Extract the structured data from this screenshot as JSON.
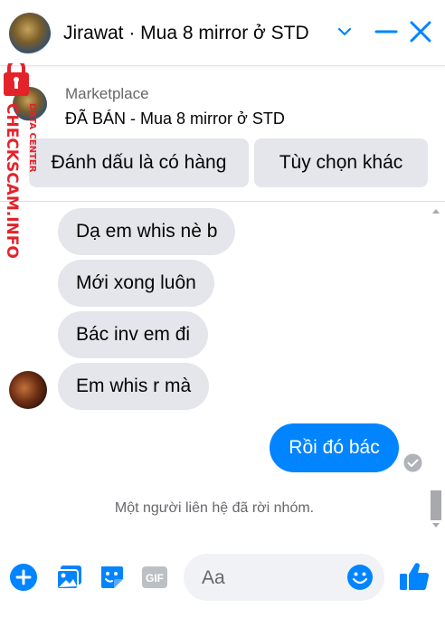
{
  "header": {
    "title": "Jirawat · Mua 8 mirror ở STD",
    "accent_color": "#0084ff"
  },
  "marketplace": {
    "label": "Marketplace",
    "listing": "ĐÃ BÁN - Mua 8 mirror ở STD"
  },
  "actions": {
    "mark_available": "Đánh dấu là có hàng",
    "more_options": "Tùy chọn khác"
  },
  "messages": {
    "incoming": [
      {
        "text": "Dạ em whis nè b"
      },
      {
        "text": "Mới xong luôn"
      },
      {
        "text": "Bác inv em đi"
      },
      {
        "text": "Em whis r mà"
      }
    ],
    "outgoing": [
      {
        "text": "Rồi đó bác"
      }
    ],
    "system_note": "Một người liên hệ đã rời nhóm."
  },
  "composer": {
    "placeholder": "Aa",
    "icons": [
      "add-icon",
      "image-icon",
      "sticker-icon",
      "gif-icon",
      "emoji-icon",
      "like-icon"
    ]
  },
  "watermark": {
    "brand": "CHECKSCAM.INFO",
    "sub": "DATA CENTER",
    "color": "#e4222a"
  }
}
